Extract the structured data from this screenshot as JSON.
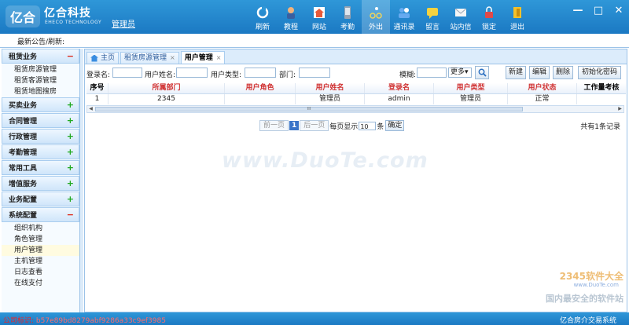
{
  "app": {
    "brand_cn": "亿合科技",
    "brand_en": "EHECO TECHNOLOGY",
    "logo_text": "亿合",
    "role": "管理员",
    "accent_color": "#1b79c3"
  },
  "toolbar": [
    {
      "label": "刷新",
      "icon": "refresh-icon",
      "color": "#ffffff"
    },
    {
      "label": "教程",
      "icon": "tutorial-icon",
      "color": "#f2b27a"
    },
    {
      "label": "网站",
      "icon": "home-icon",
      "color": "#e85a3a"
    },
    {
      "label": "考勤",
      "icon": "phone-icon",
      "color": "#9aa4b3"
    },
    {
      "label": "外出",
      "icon": "bicycle-icon",
      "color": "#f0d45a"
    },
    {
      "label": "通讯录",
      "icon": "contacts-icon",
      "color": "#66aaf0"
    },
    {
      "label": "留言",
      "icon": "chat-icon",
      "color": "#f5d23f"
    },
    {
      "label": "站内信",
      "icon": "mail-icon",
      "color": "#f5f5f5"
    },
    {
      "label": "锁定",
      "icon": "lock-icon",
      "color": "#e04a4a"
    },
    {
      "label": "退出",
      "icon": "exit-icon",
      "color": "#f5c12a"
    }
  ],
  "window_controls": {
    "minimize": "—",
    "maximize": "□",
    "close": "✕"
  },
  "notice": {
    "label": "最新公告/刷新:"
  },
  "sidebar": {
    "groups": [
      {
        "label": "租赁业务",
        "sign": "−",
        "expanded": true,
        "items": [
          "租赁房源管理",
          "租赁客源管理",
          "租赁地图搜房"
        ]
      },
      {
        "label": "买卖业务",
        "sign": "+",
        "expanded": false,
        "items": []
      },
      {
        "label": "合同管理",
        "sign": "+",
        "expanded": false,
        "items": []
      },
      {
        "label": "行政管理",
        "sign": "+",
        "expanded": false,
        "items": []
      },
      {
        "label": "考勤管理",
        "sign": "+",
        "expanded": false,
        "items": []
      },
      {
        "label": "常用工具",
        "sign": "+",
        "expanded": false,
        "items": []
      },
      {
        "label": "增值服务",
        "sign": "+",
        "expanded": false,
        "items": []
      },
      {
        "label": "业务配置",
        "sign": "+",
        "expanded": false,
        "items": []
      },
      {
        "label": "系统配置",
        "sign": "−",
        "expanded": true,
        "items": [
          "组织机构",
          "角色管理",
          "用户管理",
          "主机管理",
          "日志查看",
          "在线支付"
        ]
      }
    ],
    "selected": "用户管理"
  },
  "tabs": [
    {
      "label": "主页",
      "active": false
    },
    {
      "label": "租赁房源管理",
      "active": false
    },
    {
      "label": "用户管理",
      "active": true
    }
  ],
  "filter": {
    "login_label": "登录名:",
    "name_label": "用户姓名:",
    "type_label": "用户类型:",
    "dept_label": "部门:",
    "fuzzy_label": "模糊:",
    "more_label": "更多▾",
    "buttons": {
      "new": "新建",
      "edit": "编辑",
      "delete": "删除",
      "reset_pwd": "初始化密码"
    }
  },
  "table": {
    "columns": [
      "序号",
      "所属部门",
      "用户角色",
      "用户姓名",
      "登录名",
      "用户类型",
      "用户状态",
      "工作量考核"
    ],
    "rows": [
      [
        "1",
        "2345",
        "",
        "管理员",
        "admin",
        "管理员",
        "正常",
        ""
      ]
    ],
    "scroll_marker": "III"
  },
  "pager": {
    "prev": "前一页",
    "page": "1",
    "next": "后一页",
    "per_page_label": "每页显示",
    "per_page": "10",
    "unit": "条",
    "confirm": "确定",
    "total": "共有1条记录"
  },
  "watermark": {
    "main": "www.DuoTe.com",
    "brand": "2345软件大全",
    "url": "www.DuoTe.com",
    "slogan": "国内最安全的软件站"
  },
  "status": {
    "label": "公司标识:",
    "code": "b57e89bd8279abf9286a33c9ef3985",
    "system": "亿合房介交易系统"
  }
}
